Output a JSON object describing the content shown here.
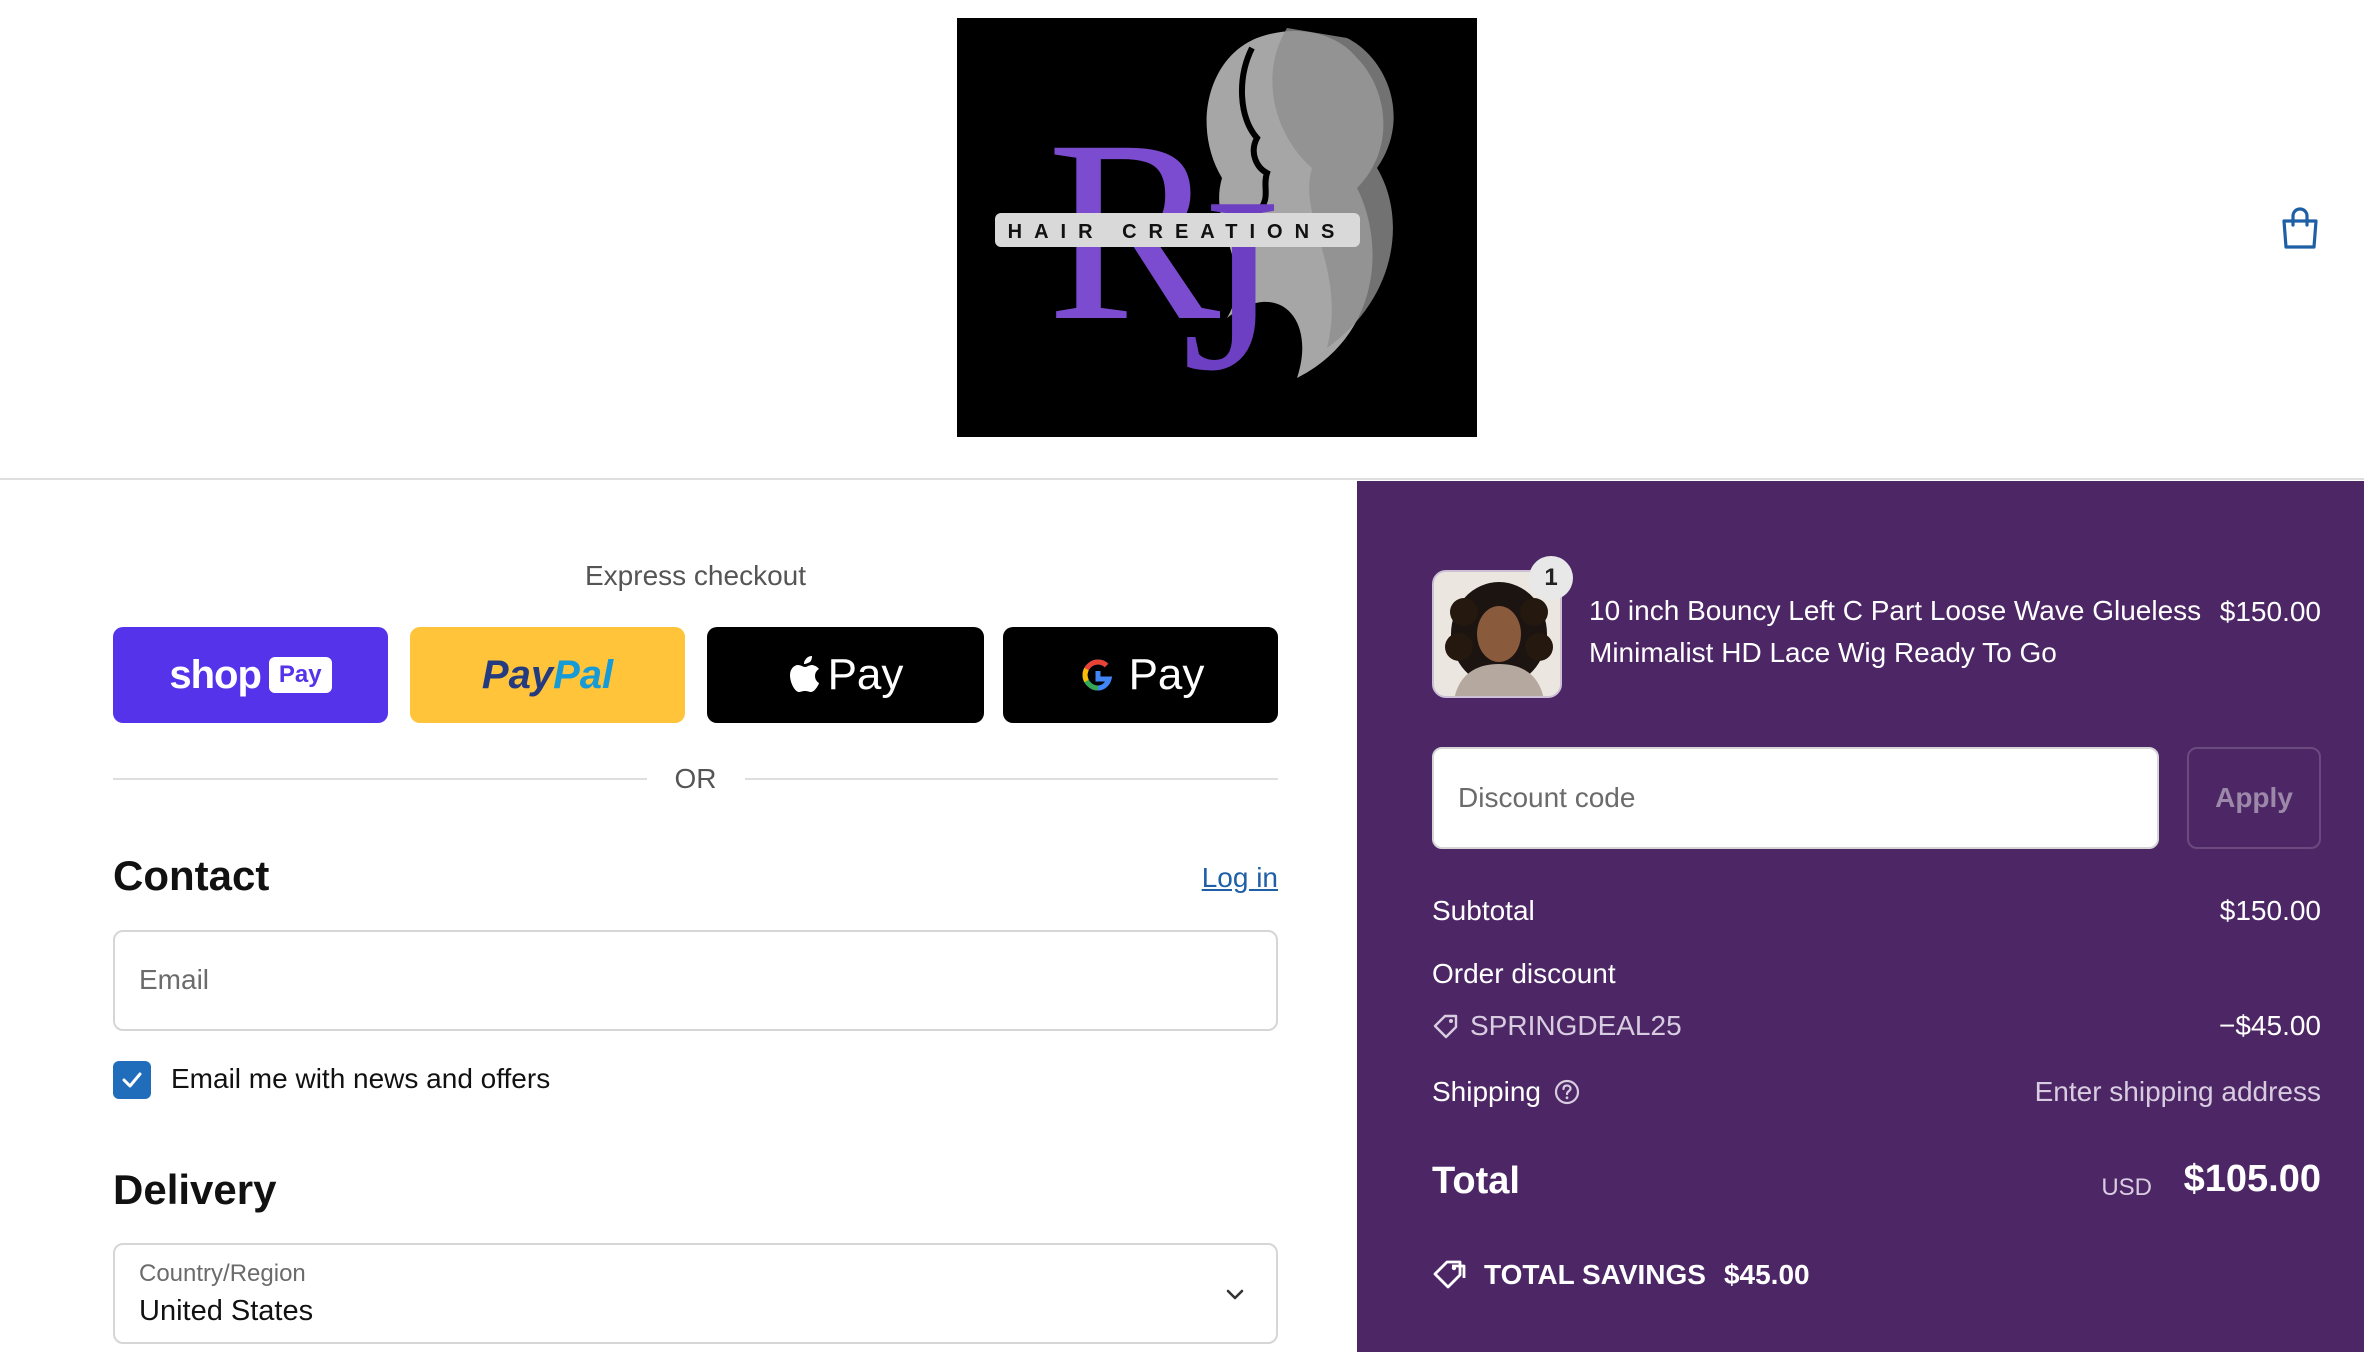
{
  "header": {
    "logo": {
      "text": "HAIR CREATIONS",
      "monogram": "RJ",
      "alt": "RJ Hair Creations logo"
    },
    "cart_icon": "shopping-bag-icon"
  },
  "express": {
    "title": "Express checkout",
    "buttons": [
      {
        "name": "shop-pay-button",
        "label": "shop",
        "badge": "Pay",
        "color": "#5433eb"
      },
      {
        "name": "paypal-button",
        "label_part1": "Pay",
        "label_part2": "Pal",
        "color": "#ffc439"
      },
      {
        "name": "apple-pay-button",
        "label": "Pay",
        "icon": "apple-icon",
        "color": "#000000"
      },
      {
        "name": "google-pay-button",
        "label": "Pay",
        "icon": "google-g-icon",
        "color": "#000000"
      }
    ],
    "or": "OR"
  },
  "contact": {
    "title": "Contact",
    "login": "Log in",
    "email_placeholder": "Email",
    "newsletter_label": "Email me with news and offers",
    "newsletter_checked": true
  },
  "delivery": {
    "title": "Delivery",
    "country_label": "Country/Region",
    "country_value": "United States"
  },
  "summary": {
    "item": {
      "quantity": "1",
      "name": "10 inch Bouncy Left C Part Loose Wave Glueless Minimalist HD Lace Wig Ready To Go",
      "price": "$150.00"
    },
    "discount_placeholder": "Discount code",
    "apply": "Apply",
    "subtotal_label": "Subtotal",
    "subtotal": "$150.00",
    "order_discount_label": "Order discount",
    "discount_code": "SPRINGDEAL25",
    "discount_amount": "−$45.00",
    "shipping_label": "Shipping",
    "shipping_value": "Enter shipping address",
    "total_label": "Total",
    "currency": "USD",
    "total": "$105.00",
    "savings_label": "TOTAL SAVINGS",
    "savings_amount": "$45.00"
  },
  "colors": {
    "panel": "#4d2666",
    "link": "#1f5fa6",
    "checkbox": "#1f6dbb",
    "logo_purple": "#7b4bd0"
  }
}
